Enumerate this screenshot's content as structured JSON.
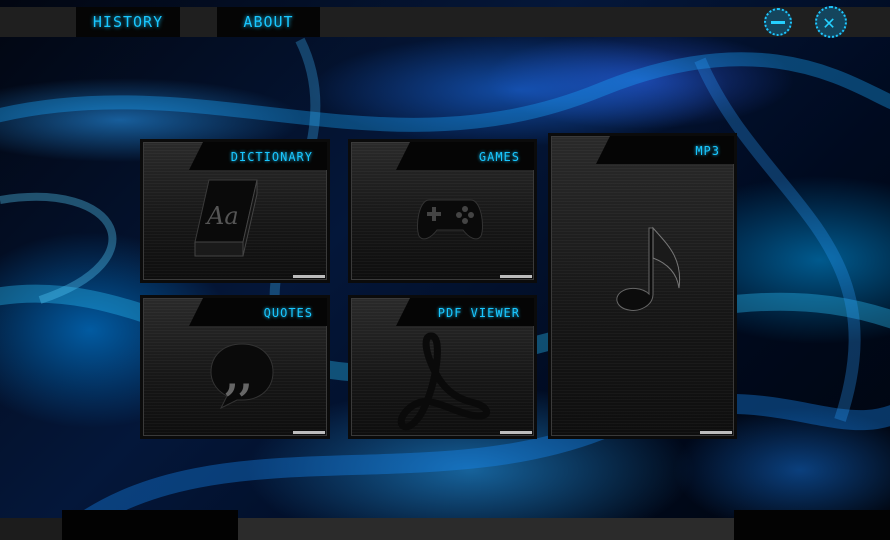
{
  "menu": {
    "history_label": "HISTORY",
    "about_label": "ABOUT"
  },
  "window_controls": {
    "minimize_icon": "minus-circle-icon",
    "close_icon": "x-circle-icon"
  },
  "tiles": [
    {
      "label": "DICTIONARY",
      "icon": "book-icon"
    },
    {
      "label": "GAMES",
      "icon": "gamepad-icon"
    },
    {
      "label": "MP3",
      "icon": "music-note-icon"
    },
    {
      "label": "QUOTES",
      "icon": "speech-bubble-icon"
    },
    {
      "label": "PDF VIEWER",
      "icon": "pdf-icon"
    }
  ],
  "colors": {
    "accent": "#19c7ff",
    "panel": "#1f1f1f"
  }
}
